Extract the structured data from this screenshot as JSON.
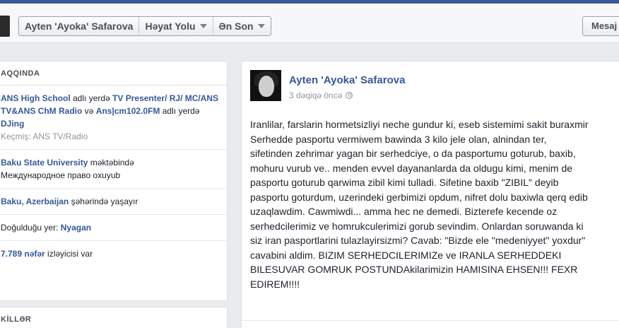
{
  "header": {
    "crumbs": [
      "Ayten 'Ayoka' Safarova",
      "Həyat Yolu",
      "Ən Son"
    ],
    "message_label": "Mesaj"
  },
  "about": {
    "title": "AQQINDA",
    "work": {
      "bold1": "ANS High School",
      "text1": " adlı yerdə ",
      "bold2": "TV Presenter/ RJ/ MC/ANS TV&ANS ChM Radio",
      "text2": " və ",
      "bold3": "Ans|cm102.0FM",
      "text3": " adlı yerdə ",
      "bold4": "DJing",
      "past": "Keçmiş: ANS TV/Radio"
    },
    "edu": {
      "bold": "Baku State University",
      "text": " məktəbində",
      "line2": "Международное право oxuyub"
    },
    "city": {
      "bold": "Baku, Azerbaijan",
      "text": " şəhərində yaşayır"
    },
    "born": {
      "text": "Doğulduğu yer: ",
      "bold": "Nyagan"
    },
    "followers": {
      "bold": "7.789 nəfər",
      "text": " izləyicisi var"
    }
  },
  "photos": {
    "title": "KİLLƏR"
  },
  "post": {
    "author": "Ayten 'Ayoka' Safarova",
    "time": "3 dəqiqə öncə",
    "lines": [
      "Iranlilar, farslarin hormetsizliyi neche gundur ki, eseb sistemimi sakit buraxmir",
      "Serhedde pasportu vermiwem bawinda 3 kilo jele olan, alnindan ter,",
      "sifetinden zehrimar yagan bir serhedciye, o da pasportumu goturub, baxib,",
      "mohuru vurub ve.. menden evvel dayananlarda da oldugu kimi, menim de",
      "pasportu goturub qarwima zibil kimi tulladi. Sifetine baxib \"ZIBIL\" deyib",
      "pasportu goturdum, uzerindeki gerbimizi opdum, nifret dolu baxiwla qerq edib",
      "uzaqlawdim. Cawmiwdi... amma hec ne demedi. Bizterefe kecende oz",
      "serhedcilerimiz ve homrukculerimizi gorub sevindim. Onlardan soruwanda ki",
      "siz iran pasportlarini tulazlayirsizmi? Cavab: \"Bizde ele \"medeniyyet\" yoxdur\"",
      "cavabini aldim. BIZIM SERHEDCILERIMIZe ve IRANLA SERHEDDEKI",
      "BILESUVAR GOMRUK POSTUNDAkilarimizin HAMISINA EHSEN!!! FEXR",
      "EDIREM!!!!"
    ]
  }
}
